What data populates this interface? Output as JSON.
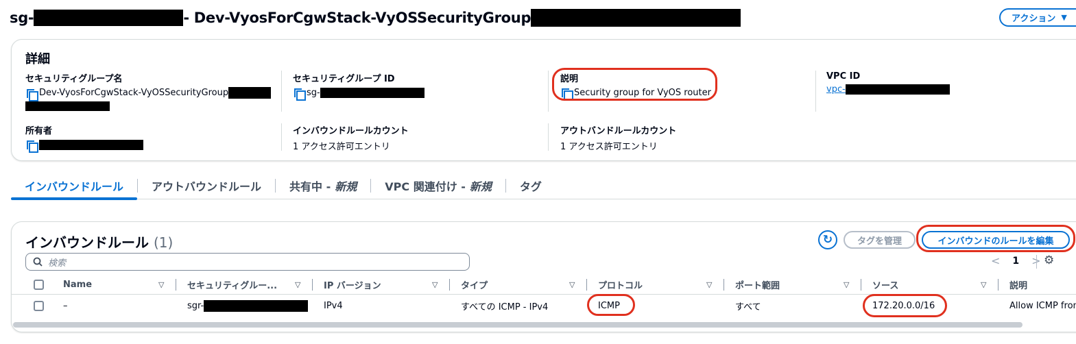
{
  "header": {
    "title_prefix": "sg-",
    "title_middle": " - Dev-VyosForCgwStack-VyOSSecurityGroup",
    "actions_label": "アクション",
    "actions_caret": "▼"
  },
  "details": {
    "title": "詳細",
    "sg_name_label": "セキュリティグループ名",
    "sg_name_value": "Dev-VyosForCgwStack-VyOSSecurityGroup",
    "sg_id_label": "セキュリティグループ ID",
    "sg_id_value": "sg-",
    "description_label": "説明",
    "description_value": "Security group for VyOS router",
    "vpc_id_label": "VPC ID",
    "vpc_id_value": "vpc-",
    "owner_label": "所有者",
    "inbound_count_label": "インバウンドルールカウント",
    "inbound_count_value": "1 アクセス許可エントリ",
    "outbound_count_label": "アウトバンドルールカウント",
    "outbound_count_value": "1 アクセス許可エントリ"
  },
  "tabs": [
    {
      "label": "インバウンドルール",
      "suffix": ""
    },
    {
      "label": "アウトバウンドルール",
      "suffix": ""
    },
    {
      "label": "共有中 -",
      "suffix": "新規"
    },
    {
      "label": "VPC 関連付け -",
      "suffix": "新規"
    },
    {
      "label": "タグ",
      "suffix": ""
    }
  ],
  "rules": {
    "title": "インバウンドルール",
    "count": "(1)",
    "refresh_icon": "refresh-icon",
    "manage_tags_label": "タグを管理",
    "edit_label": "インバウンドのルールを編集",
    "search_placeholder": "検索",
    "page_prev": "<",
    "page_number": "1",
    "page_next": ">",
    "gear": "⚙",
    "columns": [
      "Name",
      "セキュリティグルー...",
      "IP バージョン",
      "タイプ",
      "プロトコル",
      "ポート範囲",
      "ソース",
      "説明"
    ],
    "rows": [
      {
        "name": "–",
        "sgr": "sgr-",
        "ip_version": "IPv4",
        "type": "すべての ICMP - IPv4",
        "protocol": "ICMP",
        "port_range": "すべて",
        "source": "172.20.0.0/16",
        "description": "Allow ICMP from"
      }
    ]
  },
  "colors": {
    "accent": "#0972d3",
    "annotation": "#e0301e",
    "border": "#d5dbdb"
  }
}
